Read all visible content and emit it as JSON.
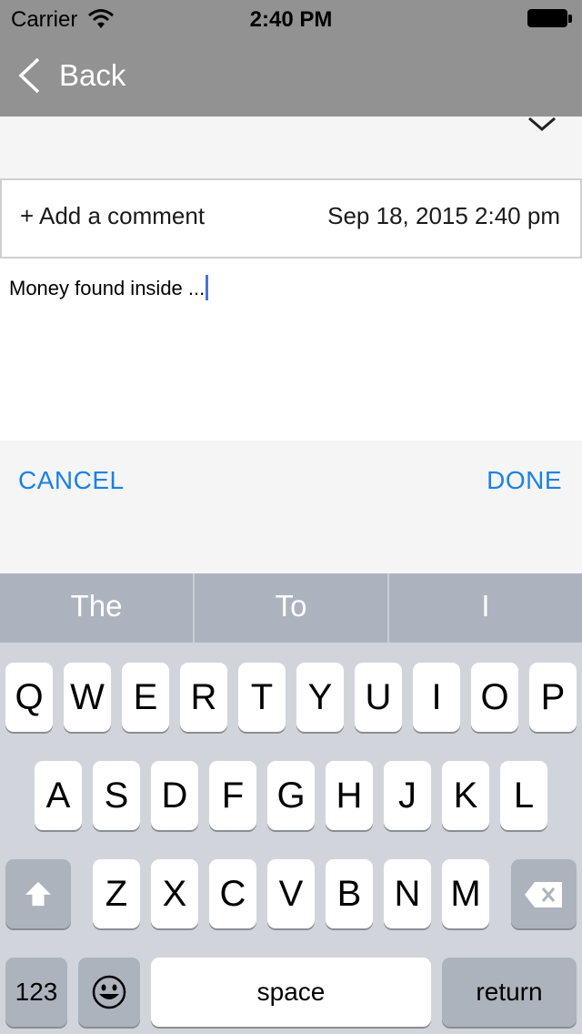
{
  "status_bar": {
    "carrier": "Carrier",
    "time": "2:40 PM"
  },
  "nav": {
    "back_label": "Back"
  },
  "comment": {
    "add_label": "+ Add a comment",
    "date": "Sep 18, 2015 2:40 pm",
    "text_value": "Money found inside ..."
  },
  "actions": {
    "cancel": "CANCEL",
    "done": "DONE"
  },
  "keyboard": {
    "predictions": [
      "The",
      "To",
      "I"
    ],
    "row1": [
      "Q",
      "W",
      "E",
      "R",
      "T",
      "Y",
      "U",
      "I",
      "O",
      "P"
    ],
    "row2": [
      "A",
      "S",
      "D",
      "F",
      "G",
      "H",
      "J",
      "K",
      "L"
    ],
    "row3": [
      "Z",
      "X",
      "C",
      "V",
      "B",
      "N",
      "M"
    ],
    "numbers_key": "123",
    "space_key": "space",
    "return_key": "return"
  },
  "colors": {
    "header": "#929292",
    "accent": "#1a82e6",
    "caret": "#4a73d6"
  },
  "icons": [
    "wifi-icon",
    "battery-icon",
    "back-chevron-icon",
    "chevron-down-icon",
    "shift-icon",
    "delete-icon",
    "emoji-icon"
  ]
}
